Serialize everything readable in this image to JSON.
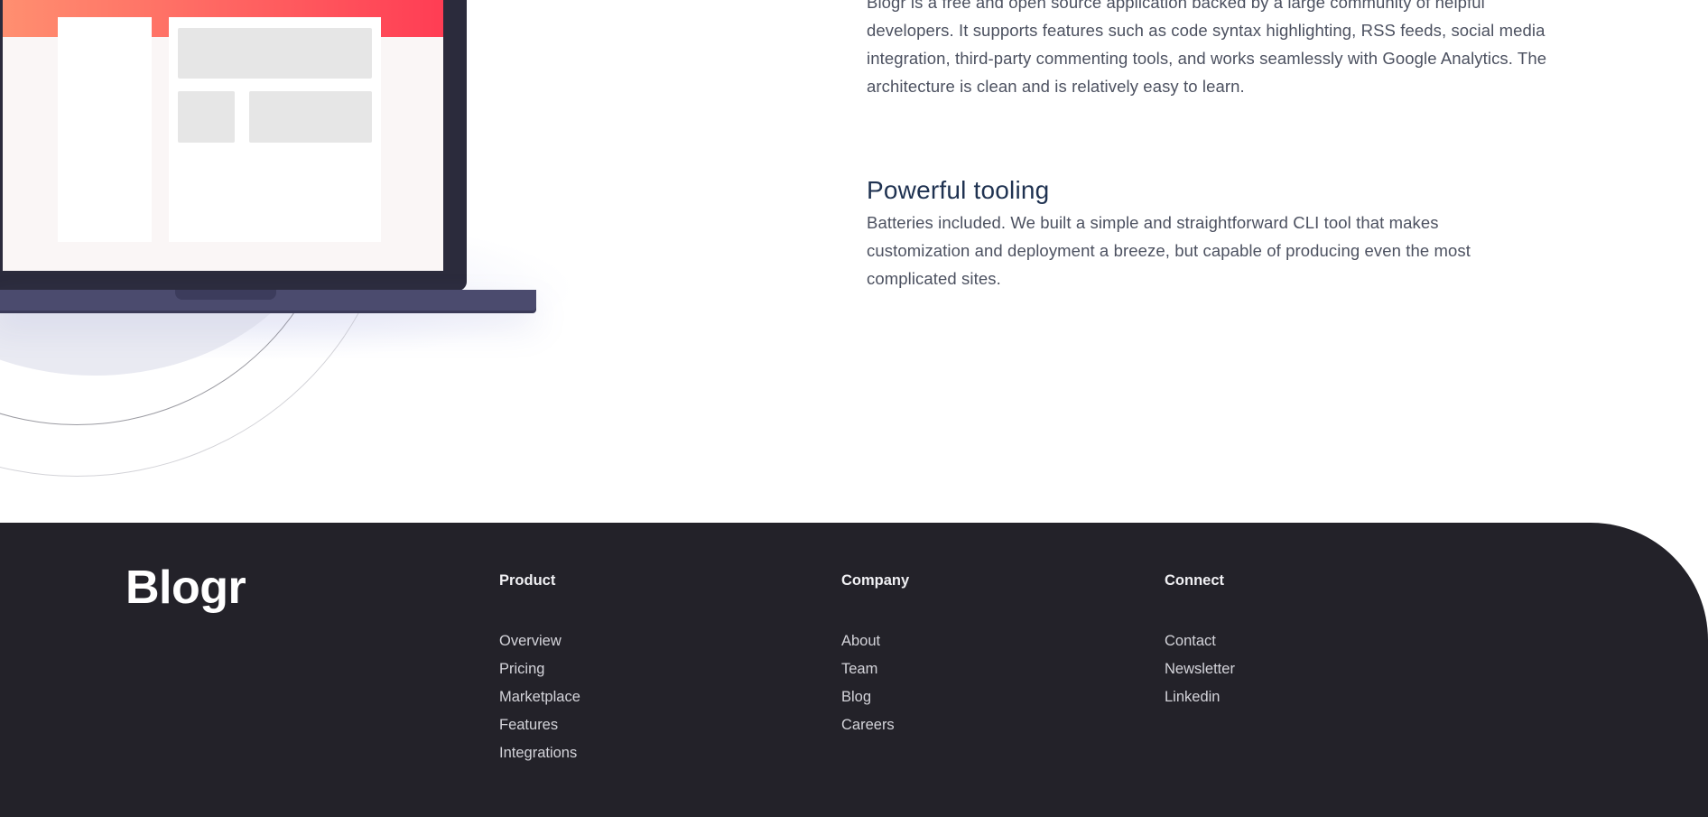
{
  "content": {
    "intro_text": "Blogr is a free and open source application backed by a large community of helpful developers. It supports features such as code syntax highlighting, RSS feeds, social media integration, third-party commenting tools, and works seamlessly with Google Analytics. The architecture is clean and is relatively easy to learn.",
    "feature": {
      "title": "Powerful tooling",
      "text": "Batteries included. We built a simple and straightforward CLI tool that makes customization and deployment a breeze, but capable of producing even the most complicated sites."
    }
  },
  "footer": {
    "logo": "Blogr",
    "columns": [
      {
        "title": "Product",
        "links": [
          "Overview",
          "Pricing",
          "Marketplace",
          "Features",
          "Integrations"
        ]
      },
      {
        "title": "Company",
        "links": [
          "About",
          "Team",
          "Blog",
          "Careers"
        ]
      },
      {
        "title": "Connect",
        "links": [
          "Contact",
          "Newsletter",
          "Linkedin"
        ]
      }
    ]
  },
  "colors": {
    "footer_bg": "#232229",
    "heading": "#1f3251",
    "body_text": "#4c5160",
    "header_gradient_start": "#ff8f70",
    "header_gradient_end": "#ff3d54"
  }
}
